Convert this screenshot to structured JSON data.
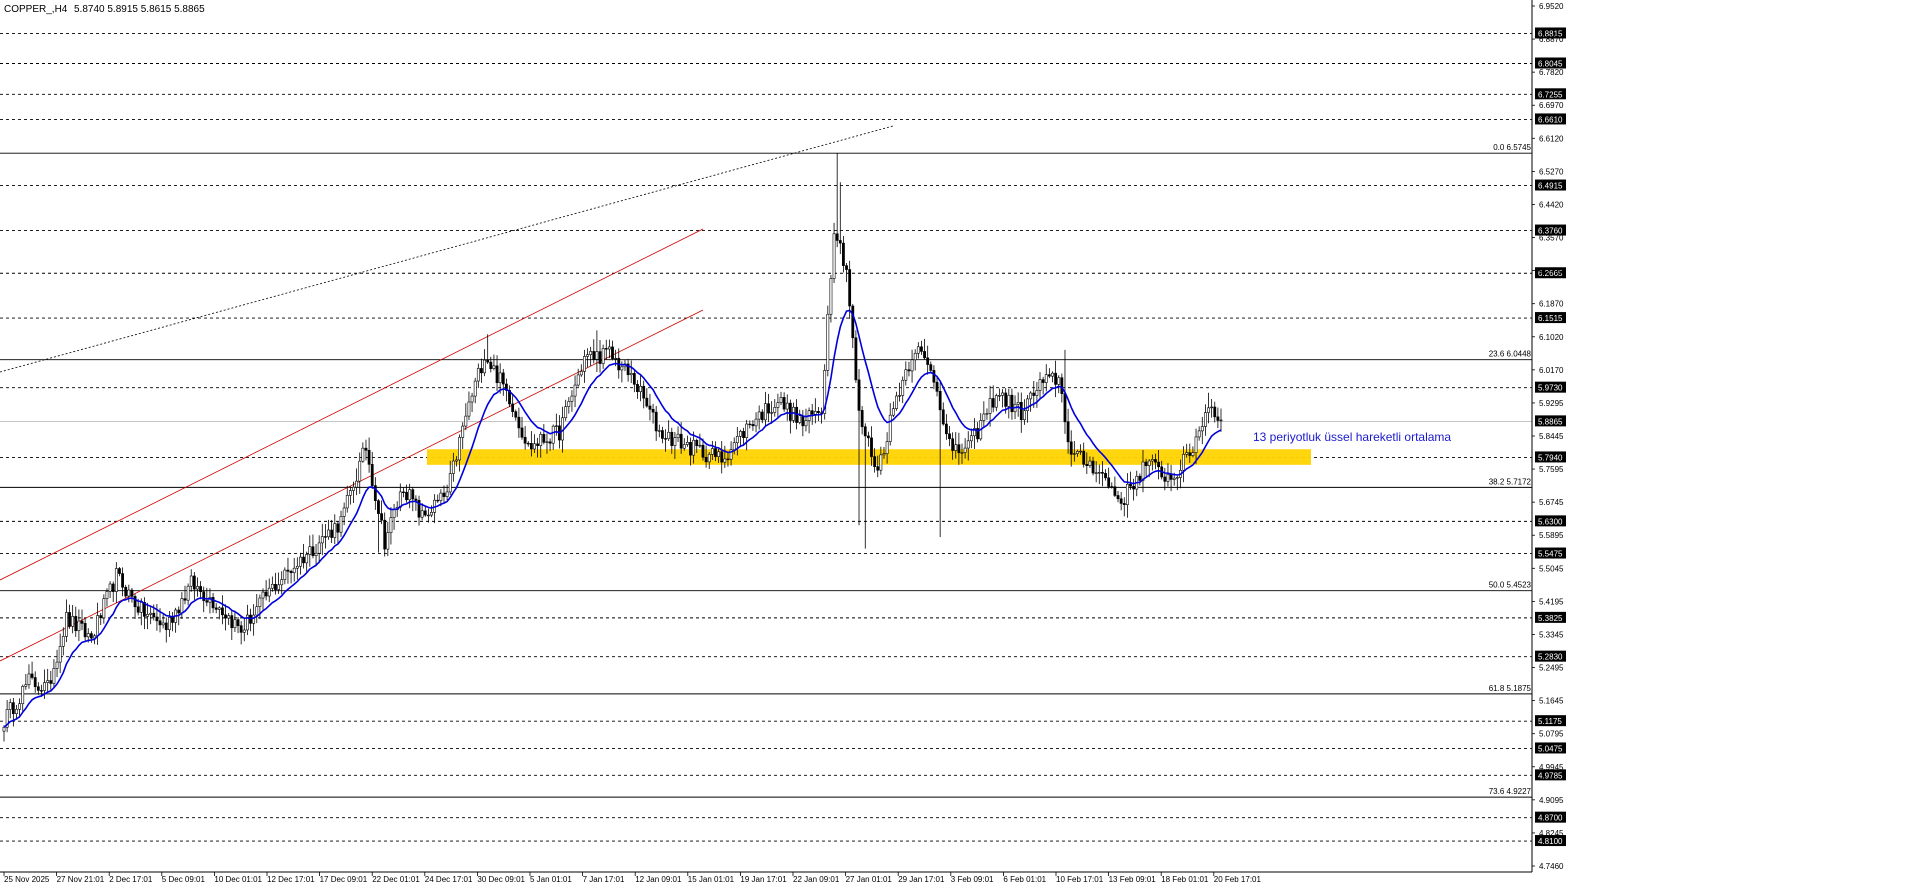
{
  "header": {
    "symbol": "COPPER_,H4",
    "ohlc": "5.8740 5.8915 5.8615 5.8865"
  },
  "colors": {
    "background": "#ffffff",
    "candle": "#000000",
    "ema": "#0000dd",
    "channel": "#cc0000",
    "support_zone": "#ffd400",
    "annotation": "#1a1acc",
    "price_tag_bg": "#000000",
    "price_tag_text": "#ffffff"
  },
  "annotation": {
    "ema_label": "13 periyotluk üssel hareketli ortalama"
  },
  "chart_data": {
    "type": "candlestick",
    "title": "COPPER_,H4",
    "ylim": [
      4.746,
      6.952
    ],
    "y_tick_labels": [
      "6.9520",
      "6.8870",
      "6.7820",
      "6.6970",
      "6.6120",
      "6.5270",
      "6.4420",
      "6.3570",
      "6.2720",
      "6.1870",
      "6.1020",
      "6.0170",
      "5.9295",
      "5.8445",
      "5.7595",
      "5.6745",
      "5.5895",
      "5.5045",
      "5.4195",
      "5.3345",
      "5.2495",
      "5.1645",
      "5.0795",
      "4.9945",
      "4.9095",
      "4.8245",
      "4.7460"
    ],
    "x_tick_labels": [
      "25 Nov 2025",
      "27 Nov 21:01",
      "2 Dec 17:01",
      "5 Dec 09:01",
      "10 Dec 01:01",
      "12 Dec 17:01",
      "17 Dec 09:01",
      "22 Dec 01:01",
      "24 Dec 17:01",
      "30 Dec 09:01",
      "5 Jan 01:01",
      "7 Jan 17:01",
      "12 Jan 09:01",
      "15 Jan 01:01",
      "19 Jan 17:01",
      "22 Jan 09:01",
      "27 Jan 01:01",
      "29 Jan 17:01",
      "3 Feb 09:01",
      "6 Feb 01:01",
      "10 Feb 17:01",
      "13 Feb 09:01",
      "18 Feb 01:01",
      "20 Feb 17:01"
    ],
    "dashed_levels": [
      {
        "price": 6.8815,
        "label": "6.8815"
      },
      {
        "price": 6.8045,
        "label": "6.8045"
      },
      {
        "price": 6.7255,
        "label": "6.7255"
      },
      {
        "price": 6.661,
        "label": "6.6610"
      },
      {
        "price": 6.4915,
        "label": "6.4915"
      },
      {
        "price": 6.376,
        "label": "6.3760"
      },
      {
        "price": 6.2665,
        "label": "6.2665"
      },
      {
        "price": 6.1515,
        "label": "6.1515"
      },
      {
        "price": 5.973,
        "label": "5.9730"
      },
      {
        "price": 5.794,
        "label": "5.7940"
      },
      {
        "price": 5.63,
        "label": "5.6300"
      },
      {
        "price": 5.5475,
        "label": "5.5475"
      },
      {
        "price": 5.3825,
        "label": "5.3825"
      },
      {
        "price": 5.283,
        "label": "5.2830"
      },
      {
        "price": 5.1175,
        "label": "5.1175"
      },
      {
        "price": 5.0475,
        "label": "5.0475"
      },
      {
        "price": 4.9785,
        "label": "4.9785"
      },
      {
        "price": 4.87,
        "label": "4.8700"
      },
      {
        "price": 4.81,
        "label": "4.8100"
      }
    ],
    "fibonacci_levels": [
      {
        "price": 6.5745,
        "label": "0.0 6.5745"
      },
      {
        "price": 6.0448,
        "label": "23.6 6.0448"
      },
      {
        "price": 5.7172,
        "label": "38.2 5.7172"
      },
      {
        "price": 5.4523,
        "label": "50.0 5.4523"
      },
      {
        "price": 5.1875,
        "label": "61.8 5.1875"
      },
      {
        "price": 4.9227,
        "label": "73.6 4.9227"
      }
    ],
    "current_price": {
      "price": 5.8865,
      "label": "5.8865"
    },
    "support_zone": {
      "low": 5.775,
      "high": 5.815
    },
    "ema_period": 13,
    "anchors": [
      [
        0,
        5.12
      ],
      [
        8,
        5.22
      ],
      [
        14,
        5.2
      ],
      [
        20,
        5.38
      ],
      [
        28,
        5.33
      ],
      [
        36,
        5.49
      ],
      [
        44,
        5.4
      ],
      [
        52,
        5.36
      ],
      [
        60,
        5.47
      ],
      [
        68,
        5.42
      ],
      [
        76,
        5.35
      ],
      [
        86,
        5.46
      ],
      [
        96,
        5.54
      ],
      [
        108,
        5.63
      ],
      [
        116,
        5.82
      ],
      [
        122,
        5.58
      ],
      [
        128,
        5.72
      ],
      [
        134,
        5.64
      ],
      [
        142,
        5.7
      ],
      [
        148,
        5.9
      ],
      [
        154,
        6.06
      ],
      [
        162,
        5.95
      ],
      [
        168,
        5.82
      ],
      [
        178,
        5.86
      ],
      [
        186,
        6.05
      ],
      [
        194,
        6.06
      ],
      [
        202,
        5.99
      ],
      [
        210,
        5.86
      ],
      [
        220,
        5.82
      ],
      [
        230,
        5.79
      ],
      [
        240,
        5.89
      ],
      [
        248,
        5.94
      ],
      [
        256,
        5.88
      ],
      [
        262,
        5.92
      ],
      [
        266,
        6.39
      ],
      [
        270,
        6.28
      ],
      [
        274,
        5.9
      ],
      [
        280,
        5.76
      ],
      [
        286,
        5.95
      ],
      [
        292,
        6.08
      ],
      [
        298,
        6.0
      ],
      [
        304,
        5.8
      ],
      [
        310,
        5.83
      ],
      [
        318,
        5.96
      ],
      [
        326,
        5.91
      ],
      [
        332,
        5.98
      ],
      [
        338,
        6.0
      ],
      [
        342,
        5.8
      ],
      [
        350,
        5.77
      ],
      [
        358,
        5.68
      ],
      [
        366,
        5.78
      ],
      [
        374,
        5.74
      ],
      [
        380,
        5.8
      ],
      [
        386,
        5.93
      ],
      [
        390,
        5.89
      ]
    ]
  }
}
